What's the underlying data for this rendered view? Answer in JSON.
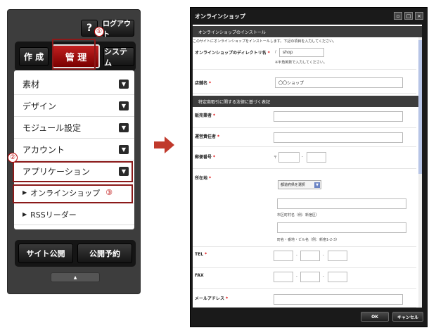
{
  "left_panel": {
    "help_label": "?",
    "logout_label": "ログアウト",
    "tabs": {
      "create": "作 成",
      "manage": "管 理",
      "system": "システム"
    },
    "menu_items": [
      {
        "label": "素材"
      },
      {
        "label": "デザイン"
      },
      {
        "label": "モジュール設定"
      },
      {
        "label": "アカウント"
      },
      {
        "label": "アプリケーション"
      }
    ],
    "sub_items": [
      {
        "label": "オンラインショップ"
      },
      {
        "label": "RSSリーダー"
      }
    ],
    "bottom_buttons": {
      "publish": "サイト公開",
      "schedule": "公開予約"
    },
    "callouts": {
      "one": "①",
      "two": "②",
      "three": "③"
    },
    "highlight_color": "#8b1a1a"
  },
  "dialog": {
    "title": "オンラインショップ",
    "section_install": "オンラインショップのインストール",
    "install_desc": "このサイトにオンラインショップをインストールします。下記の項目を入力してください。",
    "dir_label": "オンラインショップのディレクトリ名",
    "dir_prefix": "/",
    "dir_value": "shop",
    "dir_hint": "※半角英数で入力してください。",
    "store_label": "店舗名",
    "store_value": "〇〇ショップ",
    "section_law": "特定商取引に関する法律に基づく表記",
    "seller_label": "販売業者",
    "manager_label": "運営責任者",
    "postal_label": "郵便番号",
    "postal_mark": "〒",
    "postal_sep": "-",
    "address_label": "所在地",
    "prefecture_select": "都道府県を選択",
    "city_hint": "市区町村名（例：新宿区）",
    "street_hint": "町名・番地・ビル名（例：新宿1-2-3）",
    "tel_label": "TEL",
    "fax_label": "FAX",
    "email_label": "メールアドレス",
    "phone_sep": "-",
    "ok_label": "OK",
    "cancel_label": "キャンセル",
    "window_controls": [
      "restore-icon",
      "maximize-icon",
      "close-icon"
    ],
    "section_color": "#3c3c3c",
    "required_color": "#dd0000"
  },
  "arrow": {
    "color": "#c0392b"
  }
}
